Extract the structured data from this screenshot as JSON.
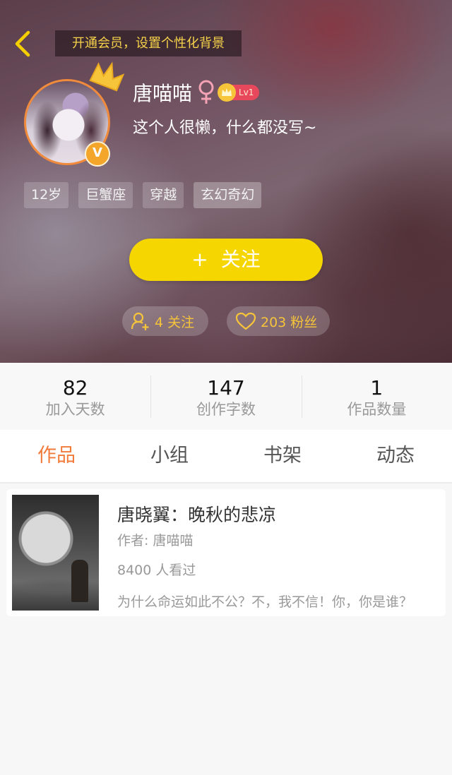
{
  "header": {
    "vip_banner": "开通会员，设置个性化背景",
    "username": "唐喵喵",
    "level": "Lv1",
    "bio": "这个人很懒，什么都没写~",
    "avatar_badge": "V",
    "tags": [
      "12岁",
      "巨蟹座",
      "穿越",
      "玄幻奇幻"
    ],
    "follow_plus": "+",
    "follow_label": "关注",
    "following_label": "4 关注",
    "fans_label": "203 粉丝",
    "colors": {
      "accent_yellow": "#f5d600",
      "avatar_ring": "#f08a3c",
      "level_badge": "#e8485c"
    },
    "icons": [
      "back-arrow-icon",
      "crown-icon",
      "female-icon",
      "vip-v-icon",
      "user-add-icon",
      "heart-icon"
    ]
  },
  "stats": [
    {
      "value": "82",
      "label": "加入天数"
    },
    {
      "value": "147",
      "label": "创作字数"
    },
    {
      "value": "1",
      "label": "作品数量"
    }
  ],
  "tabs": [
    {
      "label": "作品",
      "active": true
    },
    {
      "label": "小组",
      "active": false
    },
    {
      "label": "书架",
      "active": false
    },
    {
      "label": "动态",
      "active": false
    }
  ],
  "work": {
    "title": "唐晓翼：晚秋的悲凉",
    "author": "作者: 唐喵喵",
    "views": "8400 人看过",
    "summary": "为什么命运如此不公？不，我不信！你，你是谁？"
  },
  "tab_active_color": "#f07a3a"
}
